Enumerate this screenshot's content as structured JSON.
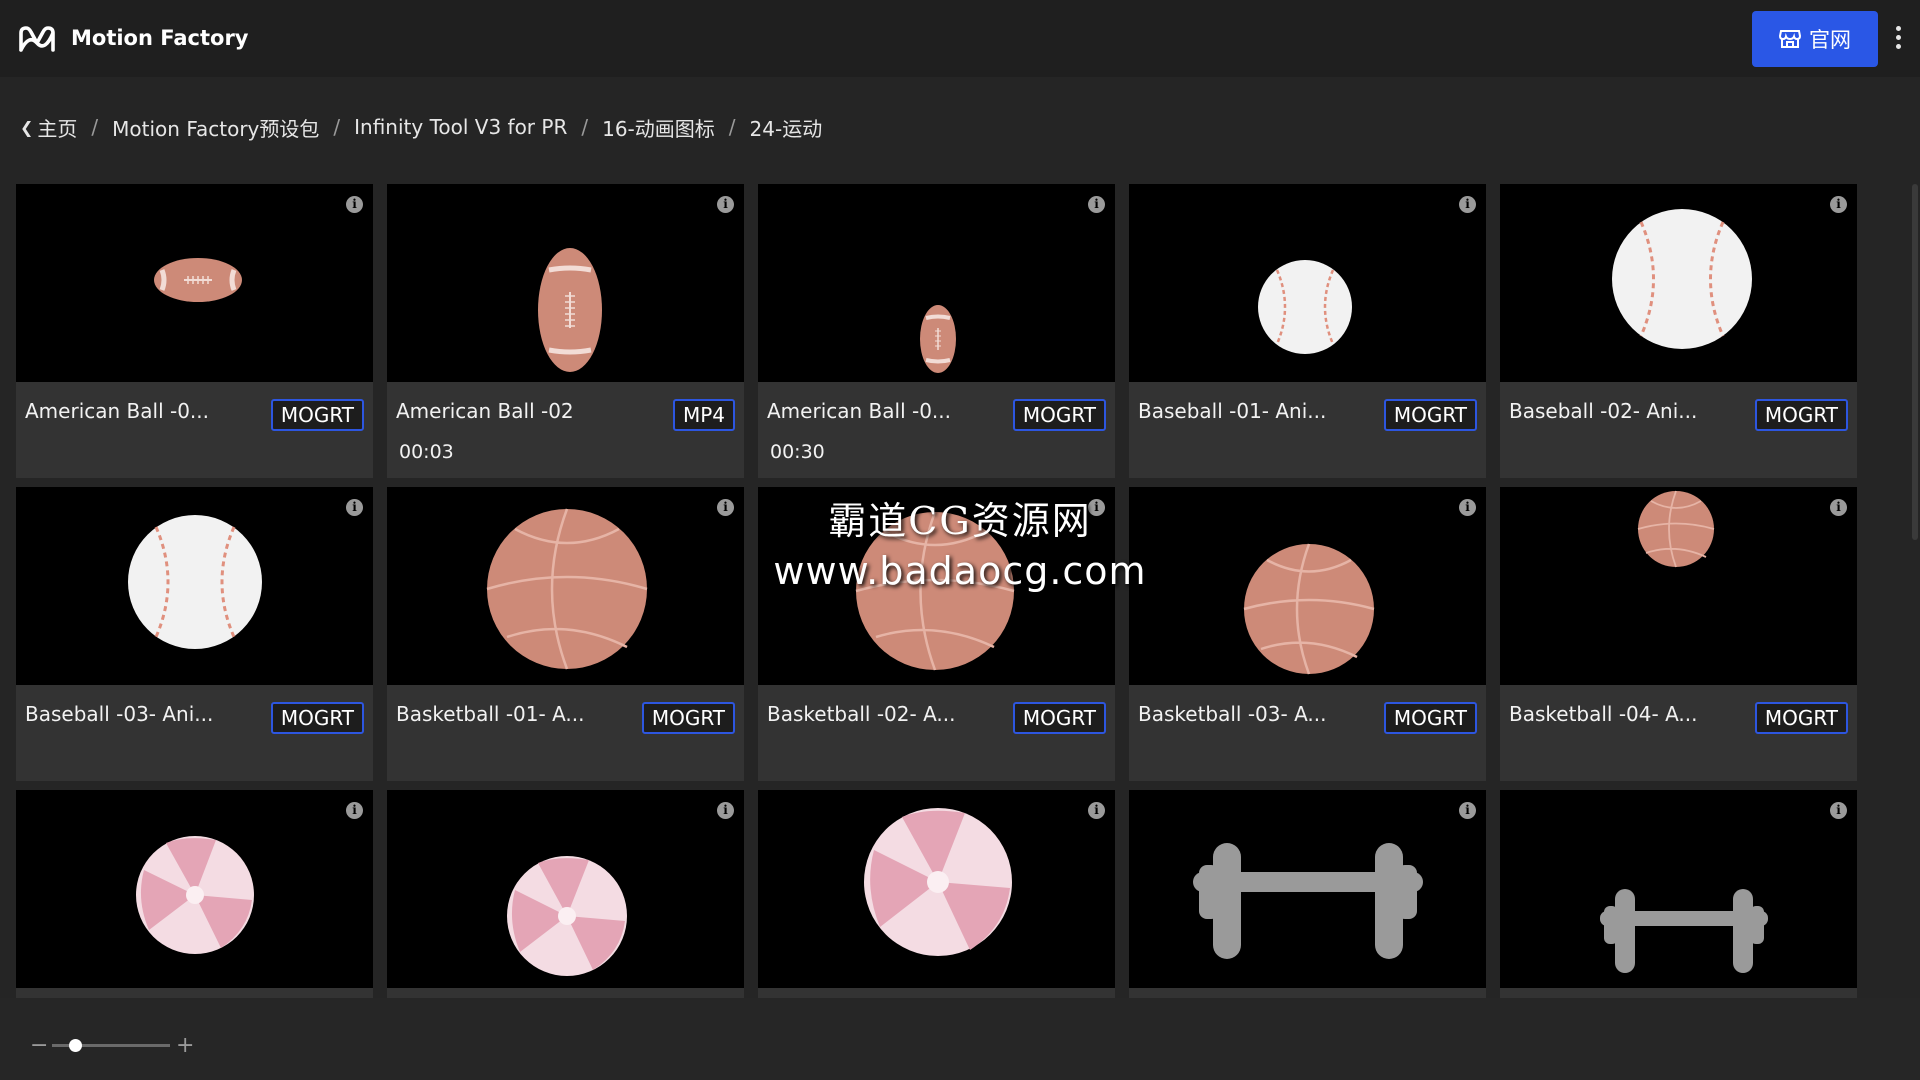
{
  "header": {
    "app_title": "Motion Factory",
    "site_button_label": "官网",
    "site_button_icon": "store-icon",
    "more_icon": "kebab-menu-icon"
  },
  "breadcrumb": [
    "主页",
    "Motion Factory预设包",
    "Infinity Tool V3 for PR",
    "16-动画图标",
    "24-运动"
  ],
  "cards": [
    {
      "name": "American Ball -0...",
      "badge": "MOGRT",
      "duration": ""
    },
    {
      "name": "American Ball -02",
      "badge": "MP4",
      "duration": "00:03"
    },
    {
      "name": "American Ball -0...",
      "badge": "MOGRT",
      "duration": "00:30"
    },
    {
      "name": "Baseball -01- Ani...",
      "badge": "MOGRT",
      "duration": ""
    },
    {
      "name": "Baseball -02- Ani...",
      "badge": "MOGRT",
      "duration": ""
    },
    {
      "name": "Baseball -03- Ani...",
      "badge": "MOGRT",
      "duration": ""
    },
    {
      "name": "Basketball -01- A...",
      "badge": "MOGRT",
      "duration": ""
    },
    {
      "name": "Basketball -02- A...",
      "badge": "MOGRT",
      "duration": ""
    },
    {
      "name": "Basketball -03- A...",
      "badge": "MOGRT",
      "duration": ""
    },
    {
      "name": "Basketball -04- A...",
      "badge": "MOGRT",
      "duration": ""
    },
    {
      "name": "",
      "badge": "",
      "duration": ""
    },
    {
      "name": "",
      "badge": "",
      "duration": ""
    },
    {
      "name": "",
      "badge": "",
      "duration": ""
    },
    {
      "name": "",
      "badge": "",
      "duration": ""
    },
    {
      "name": "",
      "badge": "",
      "duration": ""
    }
  ],
  "watermark": {
    "line1": "霸道CG资源网",
    "line2": "www.badaocg.com"
  },
  "zoom": {
    "minus_label": "−",
    "plus_label": "+",
    "level": 0.2
  },
  "colors": {
    "accent": "#2a57e6",
    "badge_border": "#2d56e0",
    "card_bg": "#333333",
    "page_bg": "#252525"
  }
}
